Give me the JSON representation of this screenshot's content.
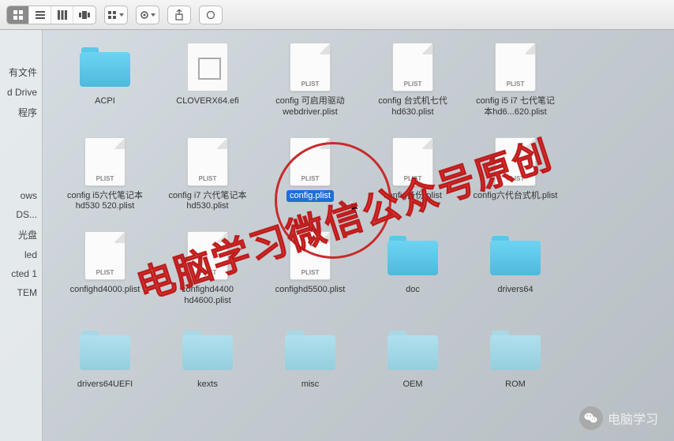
{
  "toolbar": {
    "view_modes": [
      "icon",
      "list",
      "column",
      "coverflow"
    ],
    "active_view": 0
  },
  "sidebar": {
    "items": [
      {
        "label": "有文件"
      },
      {
        "label": "d Drive"
      },
      {
        "label": "程序"
      },
      {
        "label": "ows"
      },
      {
        "label": "DS..."
      },
      {
        "label": "光盘"
      },
      {
        "label": "led"
      },
      {
        "label": "cted 1"
      },
      {
        "label": "TEM"
      }
    ]
  },
  "files": [
    {
      "name": "ACPI",
      "type": "folder"
    },
    {
      "name": "CLOVERX64.efi",
      "type": "efi"
    },
    {
      "name": "config 可启用驱动webdriver.plist",
      "type": "plist"
    },
    {
      "name": "config 台式机七代hd630.plist",
      "type": "plist"
    },
    {
      "name": "config i5 i7 七代笔记本hd6...620.plist",
      "type": "plist"
    },
    {
      "name": "",
      "type": "blank"
    },
    {
      "name": "config i5六代笔记本hd530 520.plist",
      "type": "plist"
    },
    {
      "name": "config i7 六代笔记本hd530.plist",
      "type": "plist"
    },
    {
      "name": "config.plist",
      "type": "plist",
      "selected": true
    },
    {
      "name": "config备份.plist",
      "type": "plist"
    },
    {
      "name": "config六代台式机.plist",
      "type": "plist"
    },
    {
      "name": "",
      "type": "blank"
    },
    {
      "name": "confighd4000.plist",
      "type": "plist"
    },
    {
      "name": "confighd4400 hd4600.plist",
      "type": "plist"
    },
    {
      "name": "confighd5500.plist",
      "type": "plist"
    },
    {
      "name": "doc",
      "type": "folder"
    },
    {
      "name": "drivers64",
      "type": "folder"
    },
    {
      "name": "",
      "type": "blank"
    },
    {
      "name": "drivers64UEFI",
      "type": "folder-faded"
    },
    {
      "name": "kexts",
      "type": "folder-faded"
    },
    {
      "name": "misc",
      "type": "folder-faded"
    },
    {
      "name": "OEM",
      "type": "folder-faded"
    },
    {
      "name": "ROM",
      "type": "folder-faded"
    }
  ],
  "plist_badge": "PLIST",
  "watermark_text": "电脑学习微信公众号原创",
  "footer_label": "电脑学习"
}
